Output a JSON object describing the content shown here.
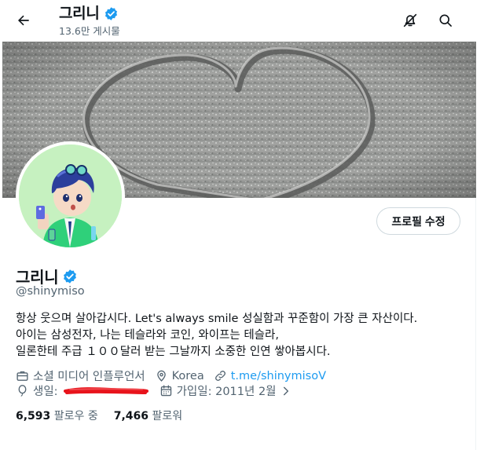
{
  "header": {
    "title": "그리니",
    "post_count": "13.6만 게시물"
  },
  "profile": {
    "name": "그리니",
    "handle": "@shinymiso",
    "edit_button": "프로필 수정",
    "bio": [
      "항상 웃으며 살아갑시다. Let's always smile 성실함과 꾸준함이 가장 큰 자산이다.",
      "아이는 삼성전자,  나는 테슬라와 코인,  와이프는 테슬라,",
      "일론한테 주급 １００달러 받는 그날까지 소중한 인연 쌓아봅시다."
    ],
    "category": "소셜 미디어 인플루언서",
    "location": "Korea",
    "website": "t.me/shinymisoV",
    "birthday_label": "생일:",
    "joined": "가입일: 2011년 2월",
    "following_count": "6,593",
    "following_label": "팔로우 중",
    "followers_count": "7,466",
    "followers_label": "팔로워"
  },
  "colors": {
    "accent": "#1d9bf0",
    "text_primary": "#0f1419",
    "text_secondary": "#536471",
    "verified": "#1d9bf0",
    "redaction": "#e8131b",
    "avatar_bg": "#c6f1c0"
  },
  "icons": {
    "back": "arrow-left-icon",
    "notifications_off": "bell-off-icon",
    "search": "search-icon",
    "verified": "verified-badge-icon",
    "category": "briefcase-icon",
    "location": "location-pin-icon",
    "website": "link-icon",
    "birthday": "balloon-icon",
    "joined": "calendar-icon",
    "chevron": "chevron-right-icon"
  }
}
